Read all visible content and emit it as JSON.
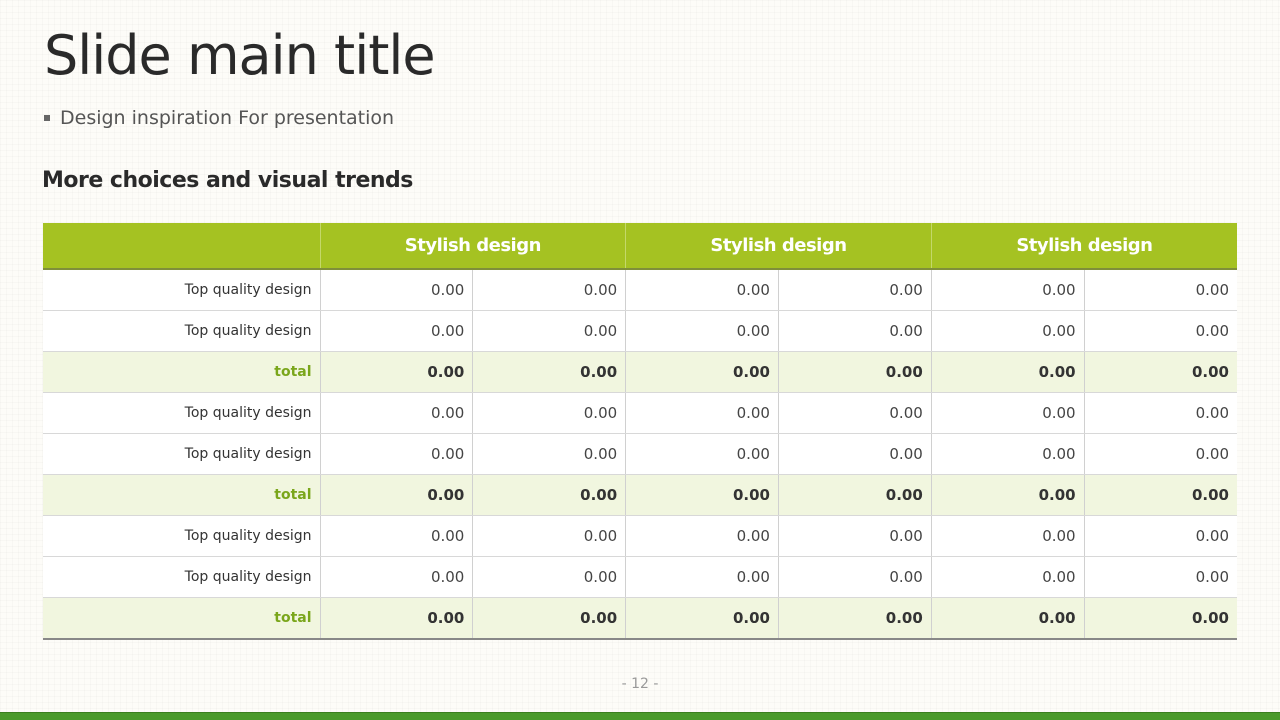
{
  "slide": {
    "title": "Slide main title",
    "subtitle": "Design inspiration For presentation",
    "section_heading": "More choices and visual trends",
    "page_number": "- 12 -"
  },
  "table": {
    "headers": [
      "",
      "Stylish design",
      "Stylish design",
      "Stylish design"
    ],
    "rows": [
      {
        "label": "Top quality design",
        "is_total": false,
        "values": [
          "0.00",
          "0.00",
          "0.00",
          "0.00",
          "0.00",
          "0.00"
        ]
      },
      {
        "label": "Top quality design",
        "is_total": false,
        "values": [
          "0.00",
          "0.00",
          "0.00",
          "0.00",
          "0.00",
          "0.00"
        ]
      },
      {
        "label": "total",
        "is_total": true,
        "values": [
          "0.00",
          "0.00",
          "0.00",
          "0.00",
          "0.00",
          "0.00"
        ]
      },
      {
        "label": "Top quality design",
        "is_total": false,
        "values": [
          "0.00",
          "0.00",
          "0.00",
          "0.00",
          "0.00",
          "0.00"
        ]
      },
      {
        "label": "Top quality design",
        "is_total": false,
        "values": [
          "0.00",
          "0.00",
          "0.00",
          "0.00",
          "0.00",
          "0.00"
        ]
      },
      {
        "label": "total",
        "is_total": true,
        "values": [
          "0.00",
          "0.00",
          "0.00",
          "0.00",
          "0.00",
          "0.00"
        ]
      },
      {
        "label": "Top quality design",
        "is_total": false,
        "values": [
          "0.00",
          "0.00",
          "0.00",
          "0.00",
          "0.00",
          "0.00"
        ]
      },
      {
        "label": "Top quality design",
        "is_total": false,
        "values": [
          "0.00",
          "0.00",
          "0.00",
          "0.00",
          "0.00",
          "0.00"
        ]
      },
      {
        "label": "total",
        "is_total": true,
        "values": [
          "0.00",
          "0.00",
          "0.00",
          "0.00",
          "0.00",
          "0.00"
        ]
      }
    ]
  },
  "colors": {
    "header_background": "#a5c222",
    "total_row_background": "#f1f6df",
    "total_label": "#7aa61b",
    "bottom_bar": "#4a9a2b"
  }
}
